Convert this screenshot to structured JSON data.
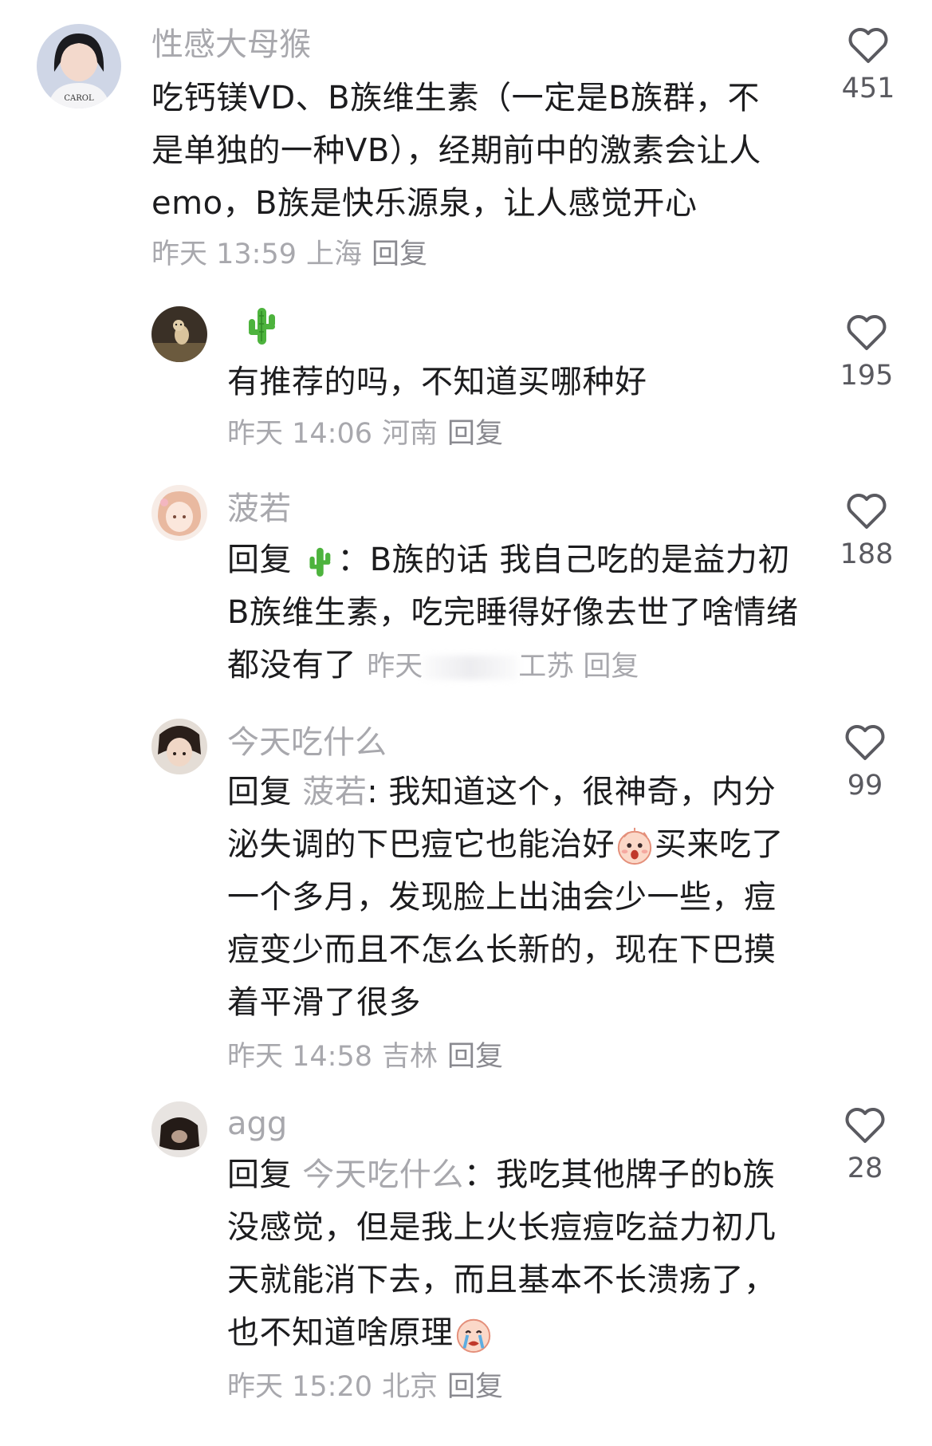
{
  "comments": [
    {
      "username": "性感大母猴",
      "text": "吃钙镁VD、B族维生素（一定是B族群，不是单独的一种VB），经期前中的激素会让人emo，B族是快乐源泉，让人感觉开心",
      "time": "昨天 13:59",
      "location": "上海",
      "reply_label": "回复",
      "likes": "451",
      "avatar_icon": "avatar-girl-icon"
    },
    {
      "username_icon": "cactus-icon",
      "text": "有推荐的吗，不知道买哪种好",
      "time": "昨天 14:06",
      "location": "河南",
      "reply_label": "回复",
      "likes": "195",
      "avatar_icon": "avatar-dog-icon"
    },
    {
      "username": "菠若",
      "reply_prefix": "回复",
      "reply_target_icon": "cactus-icon",
      "text_after": "：B族的话 我自己吃的是益力初B族维生素，吃完睡得好像去世了啥情绪都没有了",
      "time_prefix": "昨天",
      "location": "江苏",
      "location_visible": "工苏",
      "reply_label": "回复",
      "likes": "188",
      "avatar_icon": "avatar-anime-icon"
    },
    {
      "username": "今天吃什么",
      "reply_prefix": "回复",
      "reply_target": "菠若",
      "text_after": ": 我知道这个，很神奇，内分泌失调的下巴痘它也能治好",
      "text_after_emoji": "买来吃了一个多月，发现脸上出油会少一些，痘痘变少而且不怎么长新的，现在下巴摸着平滑了很多",
      "time": "昨天 14:58",
      "location": "吉林",
      "reply_label": "回复",
      "likes": "99",
      "avatar_icon": "avatar-upside-down-icon"
    },
    {
      "username": "agg",
      "reply_prefix": "回复",
      "reply_target": "今天吃什么",
      "text_after": "：我吃其他牌子的b族没感觉，但是我上火长痘痘吃益力初几天就能消下去，而且基本不长溃疡了，也不知道啥原理",
      "time": "昨天 15:20",
      "location": "北京",
      "reply_label": "回复",
      "likes": "28",
      "avatar_icon": "avatar-dark-icon"
    }
  ],
  "colors": {
    "text": "#1c1c1e",
    "muted": "#a8a8ad",
    "heart_stroke": "#5a5a60"
  }
}
